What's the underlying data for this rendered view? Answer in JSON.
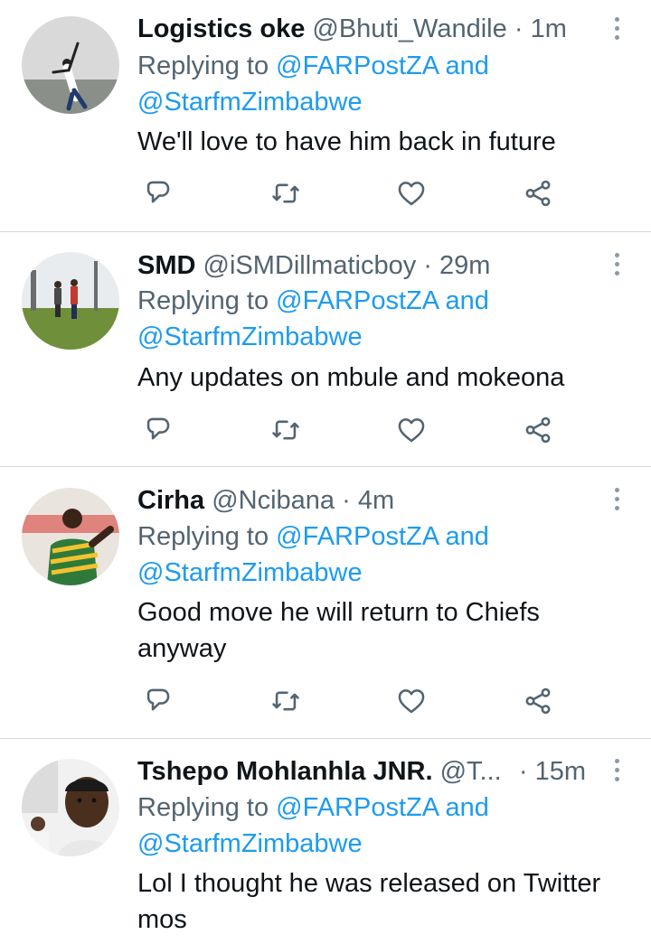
{
  "tweets": [
    {
      "name": "Logistics oke",
      "handle": "@Bhuti_Wandile",
      "time": "1m",
      "replying_prefix": "Replying to",
      "mention1": "@FARPostZA",
      "and": "and",
      "mention2": "@StarfmZimbabwe",
      "text": "We'll love to have him back in future"
    },
    {
      "name": "SMD",
      "handle": "@iSMDillmaticboy",
      "time": "29m",
      "replying_prefix": "Replying to",
      "mention1": "@FARPostZA",
      "and": "and",
      "mention2": "@StarfmZimbabwe",
      "text": "Any updates on mbule and mokeona"
    },
    {
      "name": "Cirha",
      "handle": "@Ncibana",
      "time": "4m",
      "replying_prefix": "Replying to",
      "mention1": "@FARPostZA",
      "and": "and",
      "mention2": "@StarfmZimbabwe",
      "text": "Good move he will return to Chiefs anyway"
    },
    {
      "name": "Tshepo Mohlanhla JNR.",
      "handle": "@T...",
      "time": "15m",
      "replying_prefix": "Replying to",
      "mention1": "@FARPostZA",
      "and": "and",
      "mention2": "@StarfmZimbabwe",
      "text": "Lol I thought he was released on Twitter mos"
    }
  ],
  "icons": {
    "reply": "reply-icon",
    "retweet": "retweet-icon",
    "like": "heart-icon",
    "share": "share-icon",
    "more": "more-vertical-icon"
  },
  "colors": {
    "name": "#0f1419",
    "secondary": "#536471",
    "mention": "#1d9bf0",
    "divider": "#cfd9de",
    "icon": "#536471"
  }
}
